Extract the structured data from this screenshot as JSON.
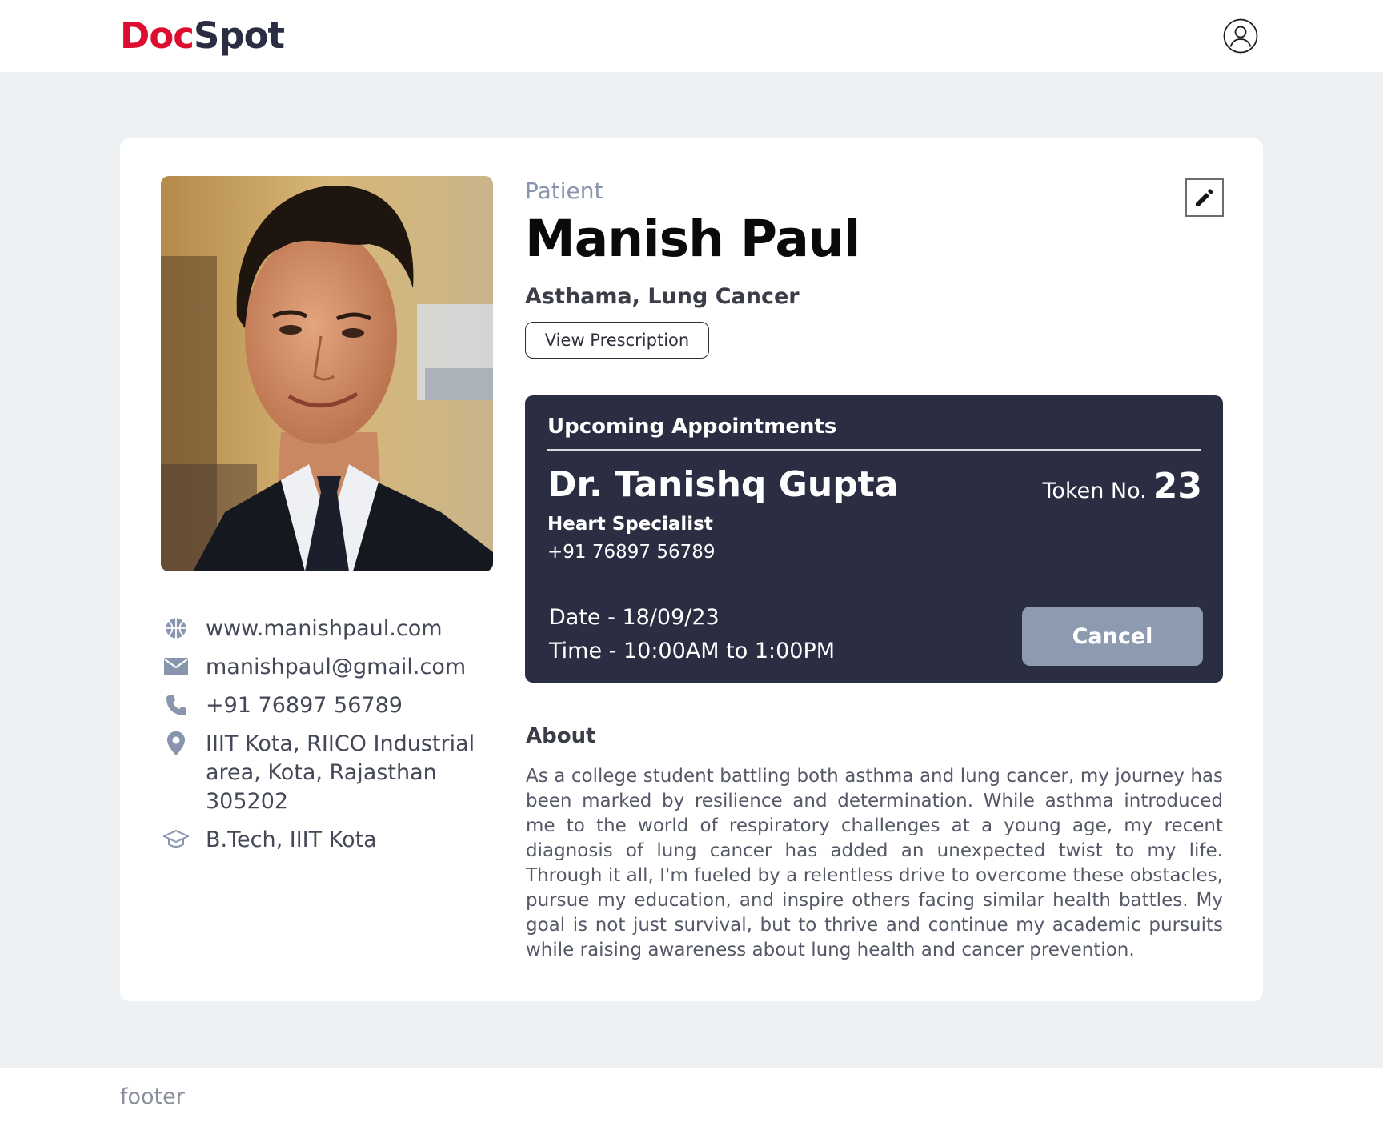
{
  "brand": {
    "part1": "Doc",
    "part2": "Spot",
    "color_primary": "#dc0d2e",
    "color_secondary": "#2b2d42"
  },
  "header": {
    "user_icon": "user-circle-icon"
  },
  "profile": {
    "role_label": "Patient",
    "name": "Manish Paul",
    "conditions": "Asthama, Lung Cancer",
    "view_prescription_label": "View Prescription",
    "edit_icon": "pencil-icon"
  },
  "contacts": [
    {
      "icon": "globe-icon",
      "text": "www.manishpaul.com"
    },
    {
      "icon": "mail-icon",
      "text": "manishpaul@gmail.com"
    },
    {
      "icon": "phone-icon",
      "text": "+91 76897 56789"
    },
    {
      "icon": "location-icon",
      "text": "IIIT Kota, RIICO Industrial area, Kota, Rajasthan 305202"
    },
    {
      "icon": "graduation-cap-icon",
      "text": "B.Tech, IIIT Kota"
    }
  ],
  "appointment": {
    "section_title": "Upcoming Appointments",
    "doctor_name": "Dr. Tanishq Gupta",
    "specialty": "Heart Specialist",
    "phone": "+91 76897 56789",
    "token_label": "Token No.",
    "token_number": "23",
    "date": "Date - 18/09/23",
    "time": "Time - 10:00AM to 1:00PM",
    "cancel_label": "Cancel",
    "panel_color": "#2b2d42",
    "cancel_color": "#8d9ab0"
  },
  "about": {
    "title": "About",
    "text": "As a college student battling both asthma and lung cancer, my journey has been marked by resilience and determination. While asthma introduced me to the world of respiratory challenges at a young age, my recent diagnosis of lung cancer has added an unexpected twist to my life. Through it all, I'm fueled by a relentless drive to overcome these obstacles, pursue my education, and inspire others facing similar health battles. My goal is not just survival, but to thrive and continue my academic pursuits while raising awareness about lung health and cancer prevention."
  },
  "footer": {
    "text": "footer"
  }
}
